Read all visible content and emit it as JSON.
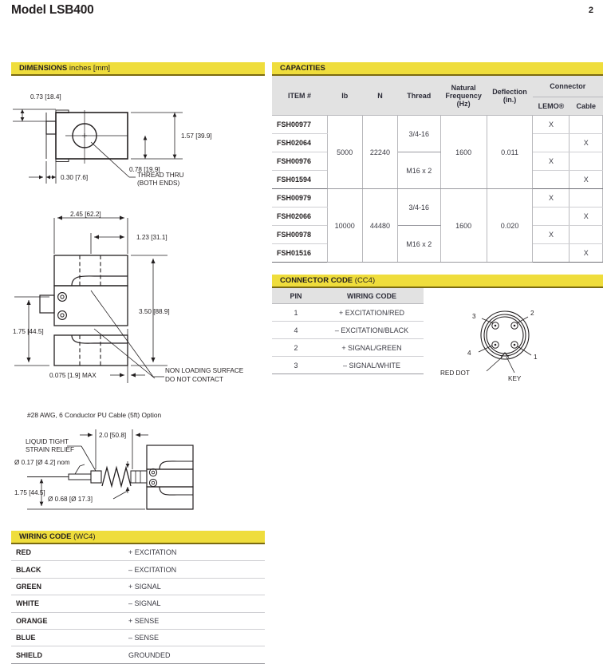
{
  "header": {
    "title": "Model LSB400",
    "page_number": "2"
  },
  "sections": {
    "dimensions": {
      "title": "DIMENSIONS",
      "subtitle": "inches [mm]"
    },
    "capacities": {
      "title": "CAPACITIES",
      "subtitle": ""
    },
    "connector_code": {
      "title": "CONNECTOR CODE",
      "subtitle": "(CC4)"
    },
    "wiring_code": {
      "title": "WIRING CODE",
      "subtitle": "(WC4)"
    }
  },
  "capacities_table": {
    "headers": {
      "item": "ITEM #",
      "lb": "lb",
      "n": "N",
      "thread": "Thread",
      "natural_frequency": "Natural Frequency (Hz)",
      "natural_frequency_l1": "Natural",
      "natural_frequency_l2": "Frequency",
      "natural_frequency_l3": "(Hz)",
      "deflection": "Deflection (in.)",
      "deflection_l1": "Deflection",
      "deflection_l2": "(in.)",
      "connector": "Connector",
      "lemo": "LEMO®",
      "cable": "Cable"
    },
    "groups": [
      {
        "lb": "5000",
        "n": "22240",
        "natural_frequency": "1600",
        "deflection": "0.011",
        "threads": [
          "3/4-16",
          "M16 x 2"
        ],
        "rows": [
          {
            "item": "FSH00977",
            "thread": "3/4-16",
            "lemo": "X",
            "cable": ""
          },
          {
            "item": "FSH02064",
            "thread": "3/4-16",
            "lemo": "",
            "cable": "X"
          },
          {
            "item": "FSH00976",
            "thread": "M16 x 2",
            "lemo": "X",
            "cable": ""
          },
          {
            "item": "FSH01594",
            "thread": "M16 x 2",
            "lemo": "",
            "cable": "X"
          }
        ]
      },
      {
        "lb": "10000",
        "n": "44480",
        "natural_frequency": "1600",
        "deflection": "0.020",
        "threads": [
          "3/4-16",
          "M16 x 2"
        ],
        "rows": [
          {
            "item": "FSH00979",
            "thread": "3/4-16",
            "lemo": "X",
            "cable": ""
          },
          {
            "item": "FSH02066",
            "thread": "3/4-16",
            "lemo": "",
            "cable": "X"
          },
          {
            "item": "FSH00978",
            "thread": "M16 x 2",
            "lemo": "X",
            "cable": ""
          },
          {
            "item": "FSH01516",
            "thread": "M16 x 2",
            "lemo": "",
            "cable": "X"
          }
        ]
      }
    ]
  },
  "connector_code_table": {
    "headers": {
      "pin": "PIN",
      "wiring_code": "WIRING CODE"
    },
    "rows": [
      {
        "pin": "1",
        "code": "+ EXCITATION/RED"
      },
      {
        "pin": "4",
        "code": "– EXCITATION/BLACK"
      },
      {
        "pin": "2",
        "code": "+ SIGNAL/GREEN"
      },
      {
        "pin": "3",
        "code": "– SIGNAL/WHITE"
      }
    ]
  },
  "connector_diagram": {
    "pin_labels": [
      "1",
      "2",
      "3",
      "4"
    ],
    "red_dot_label": "RED DOT",
    "key_label": "KEY"
  },
  "wiring_code_table": {
    "rows": [
      {
        "color": "RED",
        "function": "+ EXCITATION"
      },
      {
        "color": "BLACK",
        "function": "– EXCITATION"
      },
      {
        "color": "GREEN",
        "function": "+ SIGNAL"
      },
      {
        "color": "WHITE",
        "function": "– SIGNAL"
      },
      {
        "color": "ORANGE",
        "function": "+ SENSE"
      },
      {
        "color": "BLUE",
        "function": "– SENSE"
      },
      {
        "color": "SHIELD",
        "function": "GROUNDED"
      }
    ]
  },
  "drawing_top": {
    "dim_073": "0.73 [18.4]",
    "dim_157": "1.57 [39.9]",
    "dim_078": "0.78 [19.9]",
    "dim_030": "0.30 [7.6]",
    "note_l1": "THREAD THRU",
    "note_l2": "(BOTH ENDS)"
  },
  "drawing_front": {
    "dim_245": "2.45 [62.2]",
    "dim_123": "1.23 [31.1]",
    "dim_350": "3.50 [88.9]",
    "dim_175": "1.75 [44.5]",
    "dim_0075": "0.075 [1.9] MAX",
    "note_l1": "NON LOADING SURFACE",
    "note_l2": "DO NOT CONTACT"
  },
  "drawing_cable": {
    "title": "#28 AWG, 6 Conductor PU Cable (5ft) Option",
    "strain_relief_l1": "LIQUID TIGHT",
    "strain_relief_l2": "STRAIN RELIEF",
    "dim_20": "2.0 [50.8]",
    "dim_017": "Ø 0.17 [Ø 4.2] nom",
    "dim_068": "Ø 0.68 [Ø 17.3]",
    "dim_175": "1.75 [44.5]"
  },
  "colors": {
    "banner": "#efdd3c",
    "banner_rule": "#7a6a10",
    "table_header_bg": "#e2e2e2",
    "text": "#231f20"
  }
}
